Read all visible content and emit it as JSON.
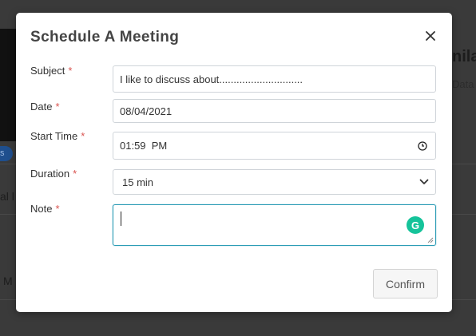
{
  "background": {
    "badge_text": "s",
    "partial_texts": [
      "al l",
      "M"
    ],
    "partial_title": "nila",
    "partial_subtitle": "Data"
  },
  "modal": {
    "title": "Schedule A Meeting",
    "close_icon": "close-icon",
    "required_marker": "*",
    "fields": {
      "subject": {
        "label": "Subject",
        "value": "I like to discuss about............................."
      },
      "date": {
        "label": "Date",
        "value": "08/04/2021"
      },
      "start_time": {
        "label": "Start Time",
        "value": "01:59  PM"
      },
      "duration": {
        "label": "Duration",
        "value": "15 min"
      },
      "note": {
        "label": "Note",
        "value": ""
      }
    },
    "grammarly_icon": "G",
    "confirm_label": "Confirm"
  },
  "colors": {
    "required": "#d9534f",
    "focus_border": "#2a9bb5",
    "grammarly": "#15c39a"
  }
}
